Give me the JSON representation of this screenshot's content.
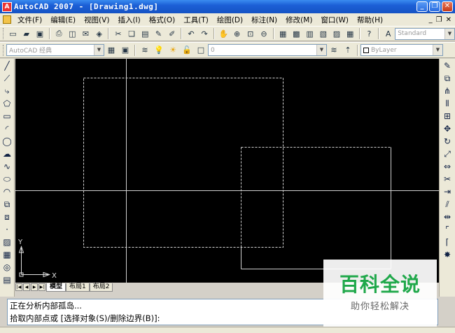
{
  "window": {
    "title": "AutoCAD 2007 - [Drawing1.dwg]",
    "app_icon": "autocad-logo-icon"
  },
  "menu": {
    "items": [
      "文件(F)",
      "编辑(E)",
      "视图(V)",
      "插入(I)",
      "格式(O)",
      "工具(T)",
      "绘图(D)",
      "标注(N)",
      "修改(M)",
      "窗口(W)",
      "帮助(H)"
    ]
  },
  "toolbar": {
    "text_style": "Standard",
    "workspace": "AutoCAD 经典",
    "layer": "0",
    "linetype": "ByLayer"
  },
  "layout_tabs": [
    "模型",
    "布局1",
    "布局2"
  ],
  "ucs": {
    "x_label": "X",
    "y_label": "Y"
  },
  "command": {
    "line1": "正在分析内部孤岛...",
    "line2": "拾取内部点或 [选择对象(S)/删除边界(B)]:"
  },
  "watermark": {
    "title": "百科全说",
    "subtitle": "助你轻松解决"
  },
  "colors": {
    "titlebar": "#1c5fd6",
    "canvas": "#000000",
    "watermark_green": "#1fa84a"
  }
}
